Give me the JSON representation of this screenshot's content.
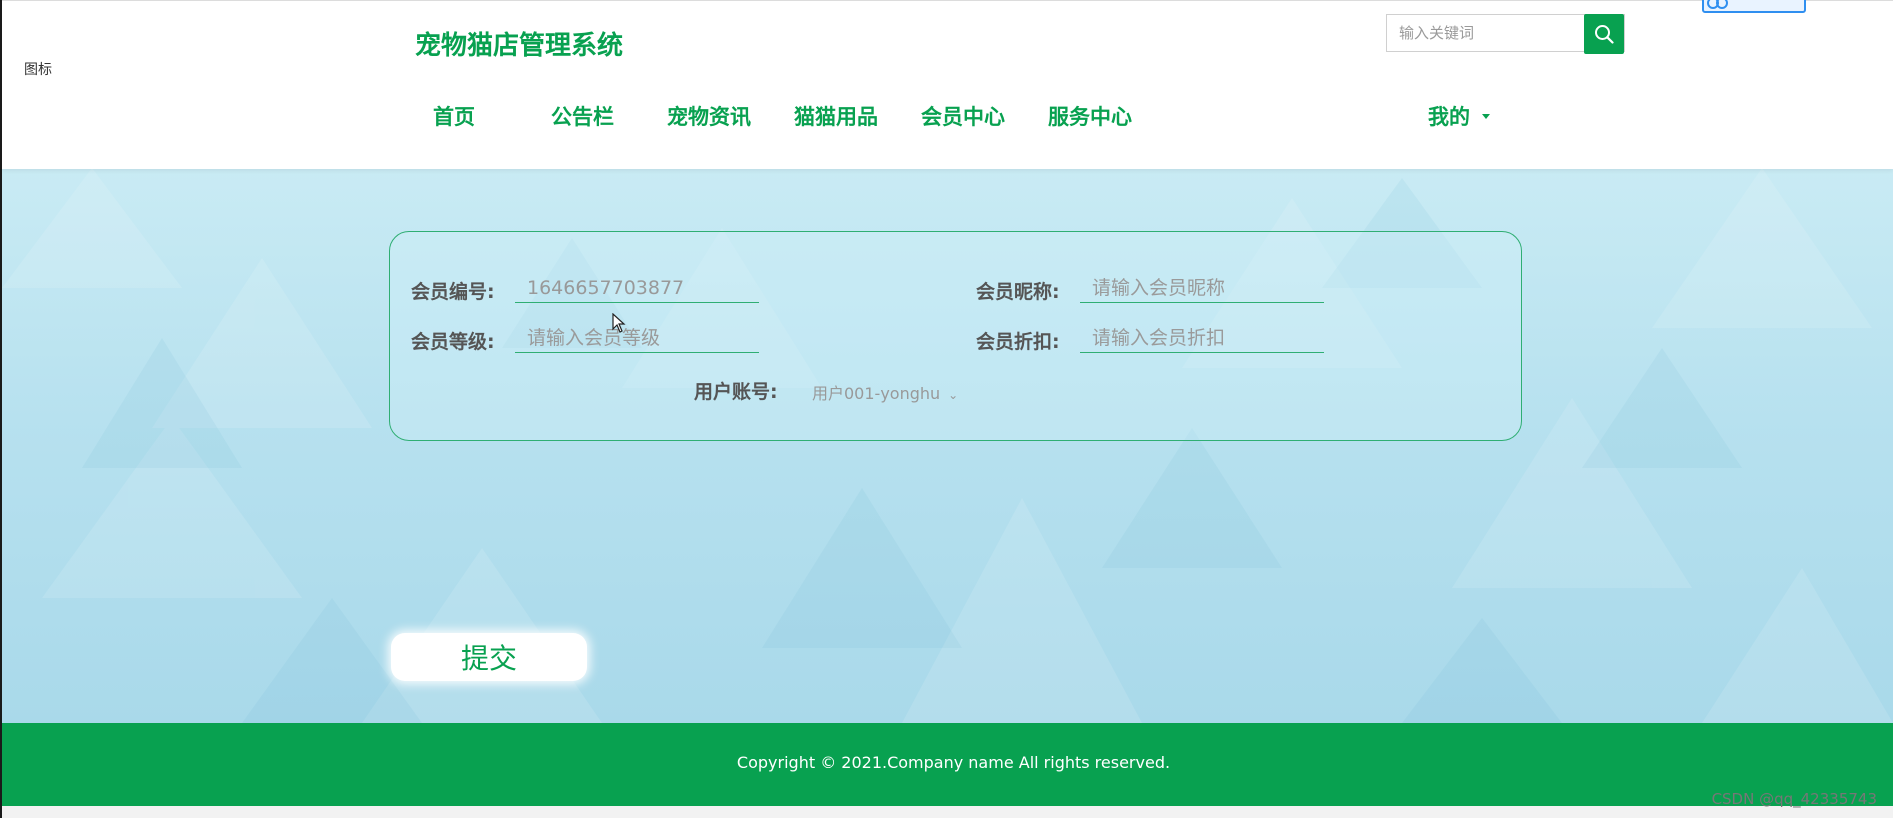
{
  "header": {
    "broken_image_alt": "图标",
    "site_title": "宠物猫店管理系统",
    "search": {
      "placeholder": "输入关键词",
      "icon": "search-icon"
    },
    "share_badge": {
      "icon": "link-icon"
    }
  },
  "nav": {
    "items": [
      {
        "label": "首页"
      },
      {
        "label": "公告栏"
      },
      {
        "label": "宠物资讯"
      },
      {
        "label": "猫猫用品"
      },
      {
        "label": "会员中心"
      },
      {
        "label": "服务中心"
      }
    ],
    "my_menu": {
      "label": "我的",
      "icon": "caret-down-icon"
    }
  },
  "form": {
    "member_id": {
      "label": "会员编号:",
      "value": "1646657703877"
    },
    "member_nickname": {
      "label": "会员昵称:",
      "placeholder": "请输入会员昵称"
    },
    "member_level": {
      "label": "会员等级:",
      "placeholder": "请输入会员等级"
    },
    "member_discount": {
      "label": "会员折扣:",
      "placeholder": "请输入会员折扣"
    },
    "user_account": {
      "label": "用户账号:",
      "selected": "用户001-yonghu",
      "icon": "chevron-down-icon"
    },
    "submit_label": "提交"
  },
  "footer": {
    "copyright": "Copyright © 2021.Company name All rights reserved."
  },
  "watermark": "CSDN @qq_42335743",
  "colors": {
    "brand_green": "#08a150",
    "border_green": "#2fae73",
    "background_blue": "#b7e1ef"
  }
}
